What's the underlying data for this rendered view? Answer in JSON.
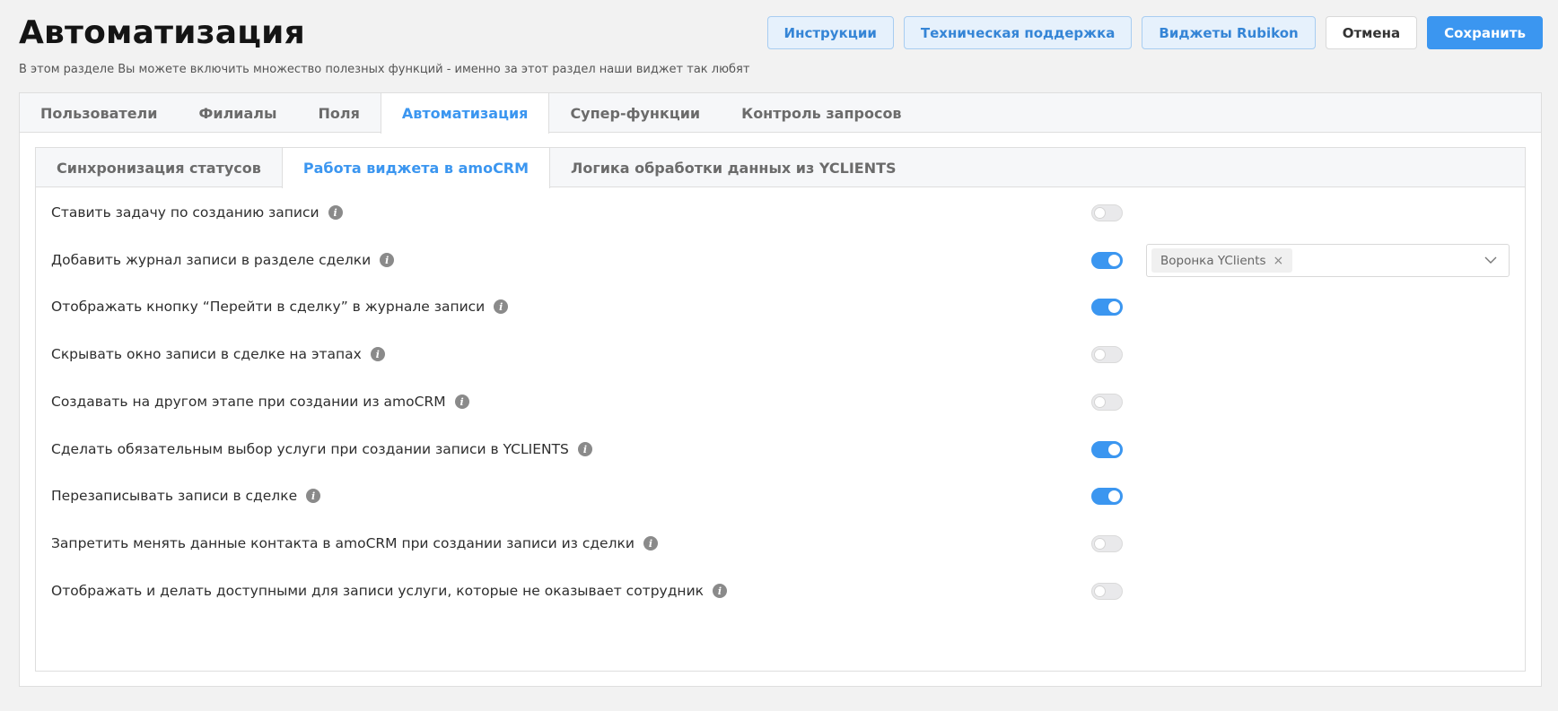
{
  "header": {
    "title": "Автоматизация",
    "subtitle": "В этом разделе Вы можете включить множество полезных функций - именно за этот раздел наши виджет так любят"
  },
  "actions": {
    "instructions": "Инструкции",
    "support": "Техническая поддержка",
    "widgets": "Виджеты Rubikon",
    "cancel": "Отмена",
    "save": "Сохранить"
  },
  "main_tabs": [
    {
      "label": "Пользователи",
      "active": false
    },
    {
      "label": "Филиалы",
      "active": false
    },
    {
      "label": "Поля",
      "active": false
    },
    {
      "label": "Автоматизация",
      "active": true
    },
    {
      "label": "Супер-функции",
      "active": false
    },
    {
      "label": "Контроль запросов",
      "active": false
    }
  ],
  "sub_tabs": [
    {
      "label": "Синхронизация статусов",
      "active": false
    },
    {
      "label": "Работа виджета в amoCRM",
      "active": true
    },
    {
      "label": "Логика обработки данных из YCLIENTS",
      "active": false
    }
  ],
  "settings": [
    {
      "label": "Ставить задачу по созданию записи",
      "enabled": false
    },
    {
      "label": "Добавить журнал записи в разделе сделки",
      "enabled": true
    },
    {
      "label": "Отображать кнопку “Перейти в сделку” в журнале записи",
      "enabled": true
    },
    {
      "label": "Скрывать окно записи в сделке на этапах",
      "enabled": false
    },
    {
      "label": "Создавать на другом этапе при создании из amoCRM",
      "enabled": false
    },
    {
      "label": "Сделать обязательным выбор услуги при создании записи в YCLIENTS",
      "enabled": true
    },
    {
      "label": "Перезаписывать записи в сделке",
      "enabled": true
    },
    {
      "label": "Запретить менять данные контакта в amoCRM при создании записи из сделки",
      "enabled": false
    },
    {
      "label": "Отображать и делать доступными для записи услуги, которые не оказывает сотрудник",
      "enabled": false
    }
  ],
  "journal_select": {
    "selected_chip": "Воронка YClients",
    "chip_close": "×"
  },
  "icons": {
    "info": "info-icon",
    "chevron": "chevron-down-icon",
    "info_glyph": "i"
  },
  "colors": {
    "accent": "#3b96f0",
    "toggle_off": "#e9e9eb"
  }
}
